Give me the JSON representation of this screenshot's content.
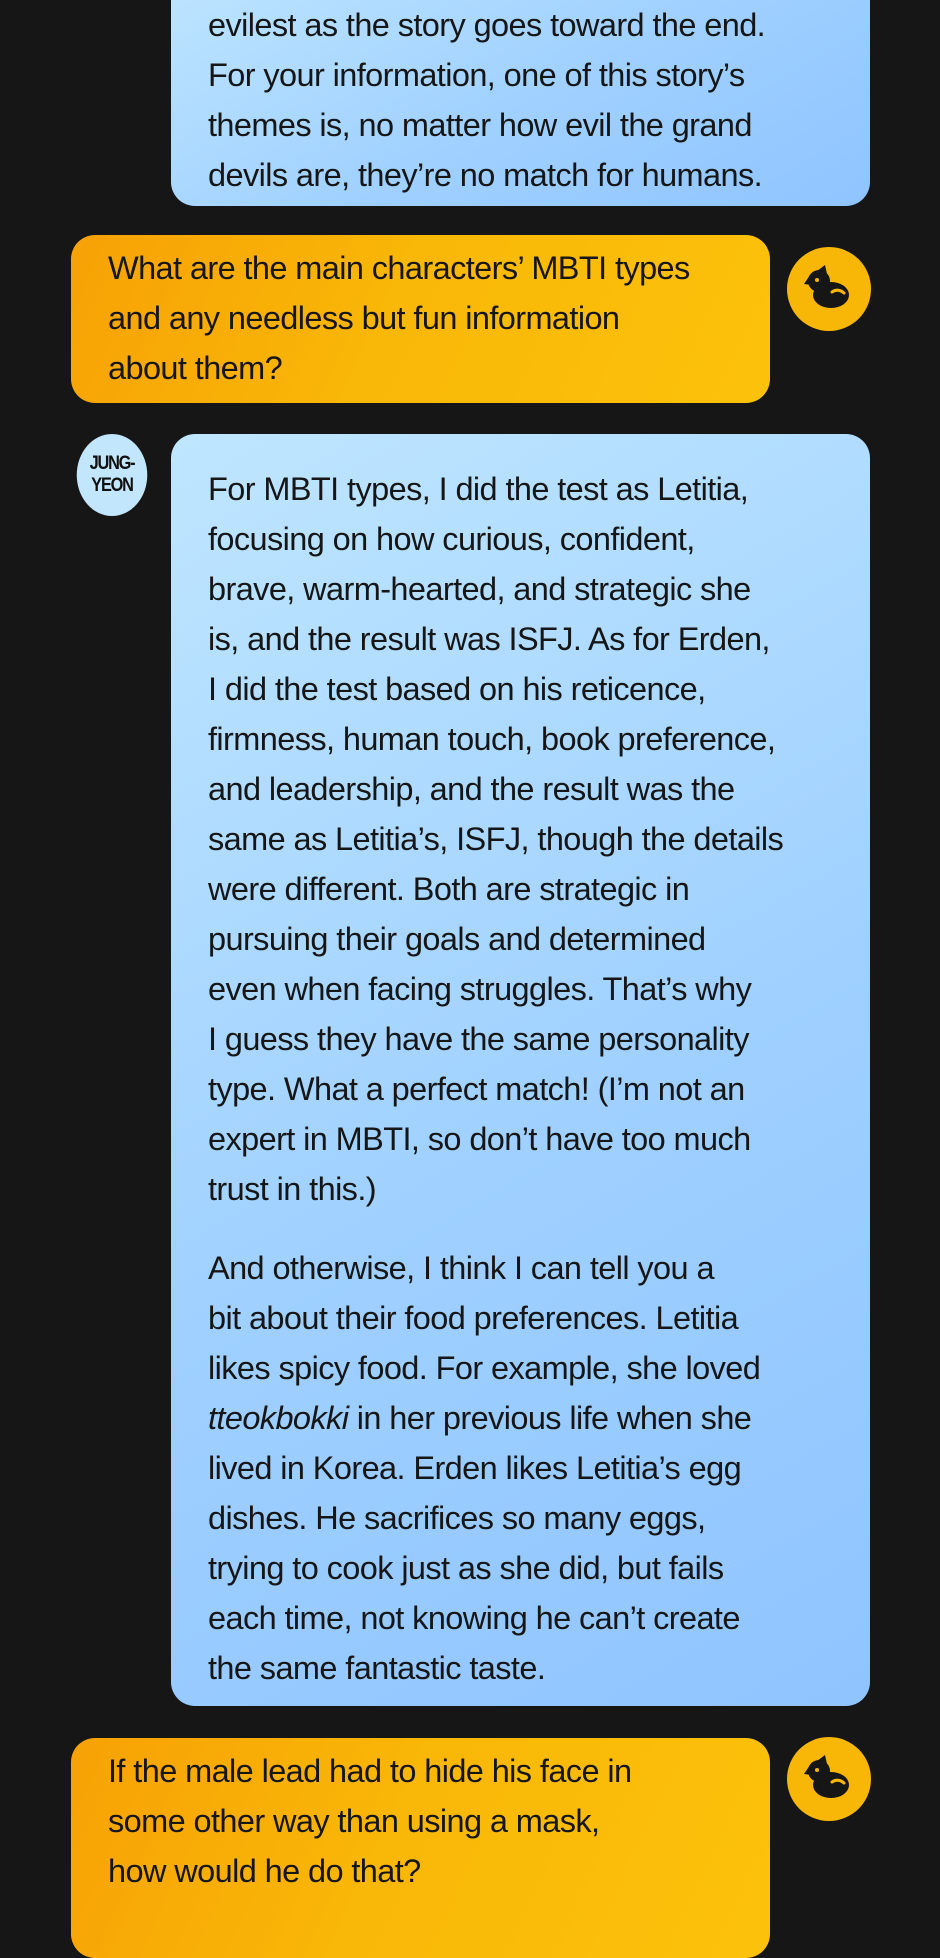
{
  "chat": {
    "messages": [
      {
        "role": "author",
        "lines": [
          "evilest as the story goes toward the end.",
          "For your information, one of this story’s",
          "themes is, no matter how evil the grand",
          "devils are, they’re no match for humans."
        ]
      },
      {
        "role": "interviewer",
        "lines": [
          "What are the main characters’ MBTI types",
          "and any needless but fun information",
          "about them?"
        ]
      },
      {
        "role": "author",
        "avatar_text": [
          "JUNG-",
          "YEON"
        ],
        "paragraphs": [
          [
            "For MBTI types, I did the test as Letitia,",
            "focusing on how curious, confident,",
            "brave, warm-hearted, and strategic she",
            "is, and the result was ISFJ. As for Erden,",
            "I did the test based on his reticence,",
            "firmness, human touch, book preference,",
            "and leadership, and the result was the",
            "same as Letitia’s, ISFJ, though the details",
            "were different. Both are strategic in",
            "pursuing their goals and determined",
            "even when facing struggles. That’s why",
            "I guess they have the same personality",
            "type. What a perfect match! (I’m not an",
            "expert in MBTI, so don’t have too much",
            "trust in this.)"
          ],
          [
            "And otherwise, I think I can tell you a",
            "bit about their food preferences. Letitia",
            "likes spicy food. For example, she loved",
            "in her previous life when she",
            "lived in Korea. Erden likes Letitia’s egg",
            "dishes. He sacrifices so many eggs,",
            "trying to cook just as she did, but fails",
            "each time, not knowing he can’t create",
            "the same fantastic taste."
          ]
        ],
        "italic_word": "tteokbokki"
      },
      {
        "role": "interviewer",
        "lines": [
          "If the male lead had to hide his face in",
          "some other way than using a mask,",
          "how would he do that?"
        ]
      }
    ]
  },
  "icons": {
    "interviewer_avatar": "dog-icon"
  },
  "colors": {
    "background": "#161616",
    "author_bubble": "#a9d7ff",
    "interviewer_bubble": "#f9b707"
  }
}
